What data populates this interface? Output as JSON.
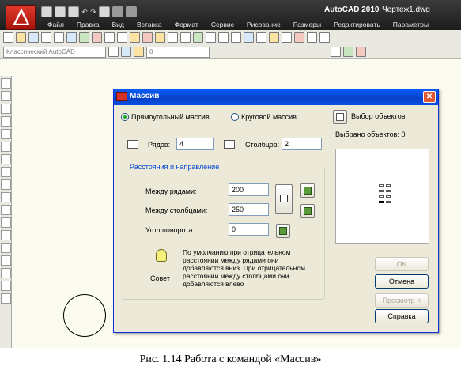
{
  "app": {
    "title": "AutoCAD 2010",
    "doc_title": "Чертеж1.dwg",
    "menus": [
      "Файл",
      "Правка",
      "Вид",
      "Вставка",
      "Формат",
      "Сервис",
      "Рисование",
      "Размеры",
      "Редактировать",
      "Параметры"
    ],
    "workspace": "Классический AutoCAD",
    "layer_value": "0"
  },
  "dialog": {
    "title": "Массив",
    "radio_rect": "Прямоугольный массив",
    "radio_polar": "Круговой массив",
    "select_objects_label": "Выбор объектов",
    "selected_count_label": "Выбрано объектов: 0",
    "rows_label": "Рядов:",
    "rows_value": "4",
    "cols_label": "Столбцов:",
    "cols_value": "2",
    "group_title": "Расстояния и направление",
    "row_offset_label": "Между рядами:",
    "row_offset_value": "200",
    "col_offset_label": "Между столбцами:",
    "col_offset_value": "250",
    "angle_label": "Угол поворота:",
    "angle_value": "0",
    "tip_text": "По умолчанию при отрицательном расстоянии между рядами они добавляются вниз. При отрицательном расстоянии между столбцами они добавляются влево",
    "tip_label": "Совет",
    "ok_label": "OK",
    "cancel_label": "Отмена",
    "preview_label": "Просмотр <",
    "help_label": "Справка"
  },
  "caption": "Рис. 1.14 Работа с командой «Массив»"
}
